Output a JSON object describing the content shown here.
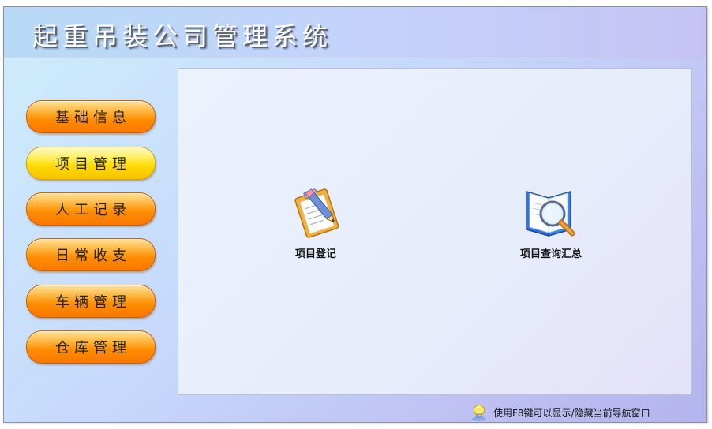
{
  "app": {
    "title": "起重吊装公司管理系统"
  },
  "sidebar": {
    "items": [
      {
        "label": "基础信息",
        "active": false
      },
      {
        "label": "项目管理",
        "active": true
      },
      {
        "label": "人工记录",
        "active": false
      },
      {
        "label": "日常收支",
        "active": false
      },
      {
        "label": "车辆管理",
        "active": false
      },
      {
        "label": "仓库管理",
        "active": false
      }
    ]
  },
  "content": {
    "modules": [
      {
        "label": "项目登记",
        "icon": "clipboard-pencil-icon"
      },
      {
        "label": "项目查询汇总",
        "icon": "book-magnifier-icon"
      }
    ]
  },
  "status": {
    "hint": "使用F8键可以显示/隐藏当前导航窗口",
    "icon": "lightbulb-icon"
  },
  "colors": {
    "nav_orange": "#ff8c00",
    "nav_active_yellow": "#ffd800",
    "title_text": "#ffffff",
    "background_start": "#cfeefc",
    "background_end": "#b3b4ec"
  }
}
